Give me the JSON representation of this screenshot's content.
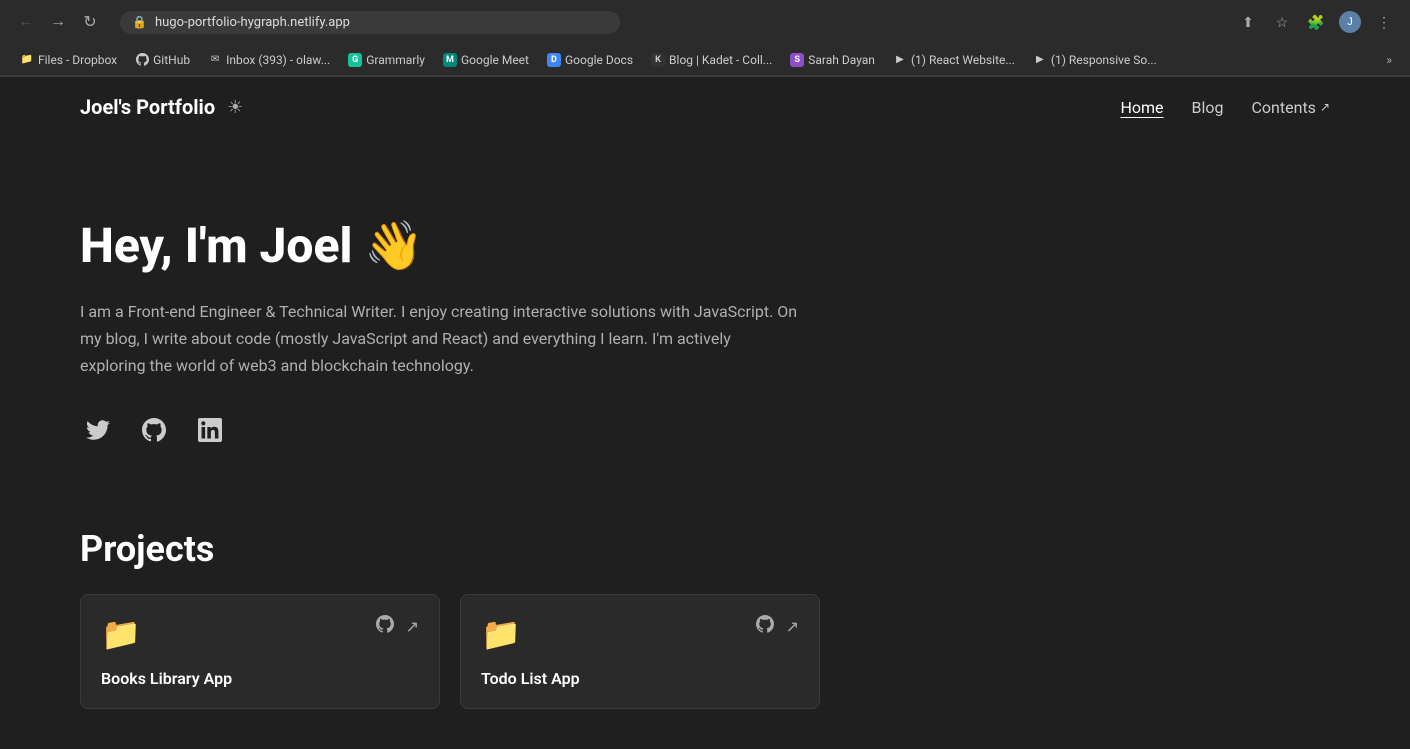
{
  "browser": {
    "url": "hugo-portfolio-hygraph.netlify.app",
    "back_disabled": true,
    "forward_disabled": false
  },
  "bookmarks": [
    {
      "id": "files-dropbox",
      "label": "Files - Dropbox",
      "icon": "📁"
    },
    {
      "id": "github",
      "label": "GitHub",
      "icon": "🐙"
    },
    {
      "id": "inbox",
      "label": "Inbox (393) - olaw...",
      "icon": "✉"
    },
    {
      "id": "grammarly",
      "label": "Grammarly",
      "icon": "G"
    },
    {
      "id": "google-meet",
      "label": "Google Meet",
      "icon": "M"
    },
    {
      "id": "google-docs",
      "label": "Google Docs",
      "icon": "D"
    },
    {
      "id": "blog-kadet",
      "label": "Blog | Kadet - Coll...",
      "icon": "K"
    },
    {
      "id": "sarah-dayan",
      "label": "Sarah Dayan",
      "icon": "S"
    },
    {
      "id": "react-website",
      "label": "(1) React Website...",
      "icon": "▶"
    },
    {
      "id": "responsive-so",
      "label": "(1) Responsive So...",
      "icon": "▶"
    }
  ],
  "site": {
    "logo": "Joel's Portfolio",
    "theme_toggle_icon": "☀",
    "nav": {
      "home": "Home",
      "blog": "Blog",
      "contents": "Contents",
      "contents_external": true
    }
  },
  "hero": {
    "greeting": "Hey, I'm Joel 👋",
    "bio": "I am a Front-end Engineer & Technical Writer. I enjoy creating interactive solutions with JavaScript. On my blog, I write about code (mostly JavaScript and React) and everything I learn. I'm actively exploring the world of web3 and blockchain technology.",
    "social": {
      "twitter_label": "Twitter",
      "github_label": "GitHub",
      "linkedin_label": "LinkedIn"
    }
  },
  "projects": {
    "section_title": "Projects",
    "items": [
      {
        "id": "books-library",
        "name": "Books Library App",
        "folder_icon": "📁",
        "github_link": true,
        "external_link": true
      },
      {
        "id": "todo-list",
        "name": "Todo List App",
        "folder_icon": "📁",
        "github_link": true,
        "external_link": true
      }
    ]
  }
}
